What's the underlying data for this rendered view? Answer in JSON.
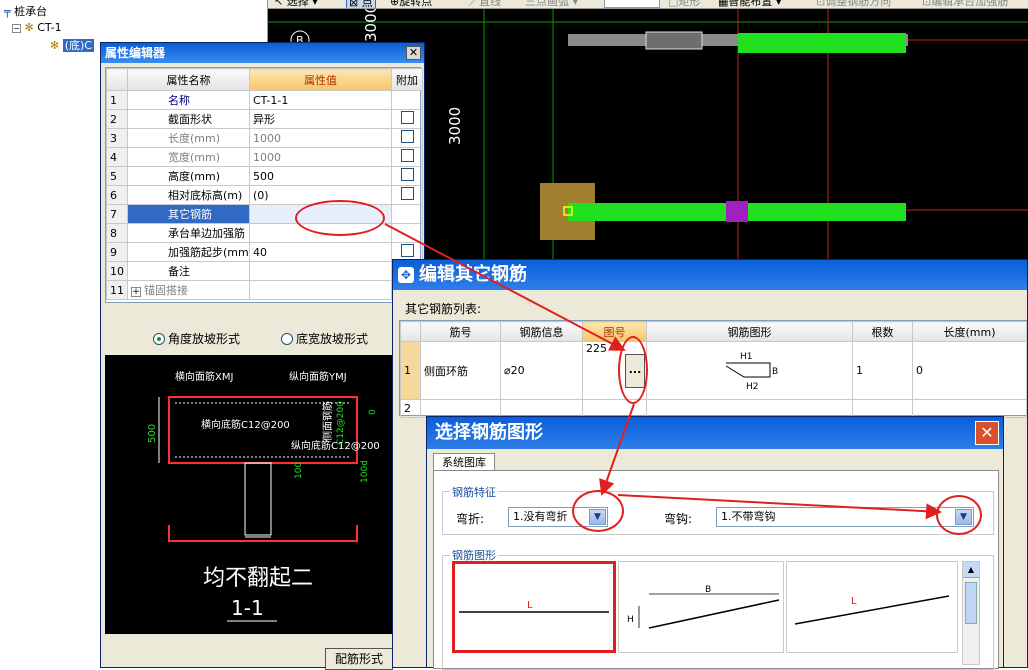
{
  "tree": {
    "root_label": "桩承台",
    "child_label": "CT-1",
    "leaf_label": "(底)C"
  },
  "cad_toolbar": {
    "select_label": "选择",
    "point_label": "点",
    "rotate_point_label": "旋转点",
    "line_label": "直线",
    "three_point_arc_label": "三点画弧",
    "rect_label": "矩形",
    "smart_layout_label": "智能布置",
    "adjust_rebar_dir_label": "调整钢筋方向",
    "edit_cap_label": "编辑承台加强筋"
  },
  "cad": {
    "dim_top": "3000",
    "dim_side": "3000",
    "axis_label": "B"
  },
  "property_editor": {
    "title": "属性编辑器",
    "columns": [
      "属性名称",
      "属性值",
      "附加"
    ],
    "rows": [
      {
        "num": "1",
        "name": "名称",
        "value": "CT-1-1",
        "style": "blue",
        "checkbox": false
      },
      {
        "num": "2",
        "name": "截面形状",
        "value": "异形",
        "style": "normal",
        "checkbox": true
      },
      {
        "num": "3",
        "name": "长度(mm)",
        "value": "1000",
        "style": "gray",
        "checkbox": true
      },
      {
        "num": "4",
        "name": "宽度(mm)",
        "value": "1000",
        "style": "gray",
        "checkbox": true
      },
      {
        "num": "5",
        "name": "高度(mm)",
        "value": "500",
        "style": "normal",
        "checkbox": true
      },
      {
        "num": "6",
        "name": "相对底标高(m)",
        "value": "(0)",
        "style": "normal",
        "checkbox": true
      },
      {
        "num": "7",
        "name": "其它钢筋",
        "value": "",
        "style": "selected",
        "checkbox": false
      },
      {
        "num": "8",
        "name": "承台单边加强筋",
        "value": "",
        "style": "normal",
        "checkbox": false
      },
      {
        "num": "9",
        "name": "加强筋起步(mm)",
        "value": "40",
        "style": "normal",
        "checkbox": true
      },
      {
        "num": "10",
        "name": "备注",
        "value": "",
        "style": "normal",
        "checkbox": false
      },
      {
        "num": "11",
        "name": "锚固搭接",
        "value": "",
        "style": "expand",
        "checkbox": false
      }
    ],
    "radio_angle": "角度放坡形式",
    "radio_width": "底宽放坡形式",
    "section": {
      "label_hxmj": "横向面筋XMJ",
      "label_zxmj": "纵向面筋YMJ",
      "label_hxdj": "横向底筋C12@200",
      "label_zxdj": "纵向底筋C12@200",
      "label_side": "侧面钢筋",
      "label_side_spec": "C12@200",
      "dim_500": "500",
      "dim_100": "100",
      "dim_100d": "100d",
      "dim_0": "0",
      "caption": "均不翻起二",
      "section_name": "1-1"
    },
    "config_button": "配筋形式"
  },
  "edit_other": {
    "title": "编辑其它钢筋",
    "list_label": "其它钢筋列表:",
    "columns": [
      "筋号",
      "钢筋信息",
      "图号",
      "钢筋图形",
      "根数",
      "长度(mm)"
    ],
    "rows": [
      {
        "num": "1",
        "bar_no": "侧面环筋",
        "info": "⌀20",
        "fig_no": "225",
        "count": "1",
        "length": "0",
        "shape_h1": "H1",
        "shape_h2": "H2",
        "shape_b": "B"
      },
      {
        "num": "2",
        "bar_no": "",
        "info": "",
        "fig_no": "",
        "count": "",
        "length": ""
      }
    ],
    "ellipsis": "..."
  },
  "select_shape": {
    "title": "选择钢筋图形",
    "tab": "系统图库",
    "features_label": "钢筋特征",
    "bend_label": "弯折:",
    "bend_value": "1.没有弯折",
    "hook_label": "弯钩:",
    "hook_value": "1.不带弯钩",
    "shapes_label": "钢筋图形",
    "shape1_label": "L",
    "shape2_label_b": "B",
    "shape2_label_h": "H",
    "shape3_label": "L"
  }
}
